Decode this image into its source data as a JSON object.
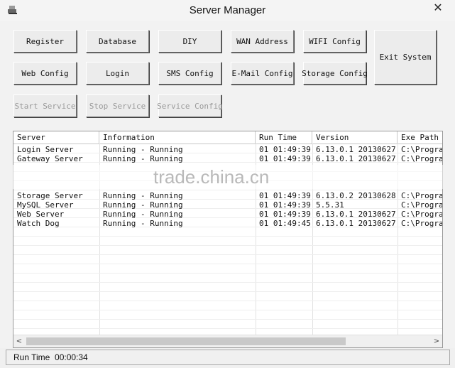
{
  "window": {
    "title": "Server Manager",
    "close_glyph": "✕",
    "icon": "server-app-icon"
  },
  "buttons": {
    "register": "Register",
    "database": "Database",
    "diy": "DIY",
    "wan_address": "WAN Address",
    "wifi_config": "WIFI Config",
    "web_config": "Web Config",
    "login": "Login",
    "sms_config": "SMS Config",
    "email_config": "E-Mail Config",
    "storage_config": "Storage Config",
    "exit_system": "Exit System",
    "start_service": "Start Service",
    "stop_service": "Stop Service",
    "service_config": "Service Config"
  },
  "table": {
    "columns": [
      "Server",
      "Information",
      "Run Time",
      "Version",
      "Exe Path"
    ],
    "rows": [
      [
        "Login Server",
        "Running - Running",
        "01 01:49:39",
        "6.13.0.1 20130627",
        "C:\\Program"
      ],
      [
        "Gateway Server",
        "Running - Running",
        "01 01:49:39",
        "6.13.0.1 20130627",
        "C:\\Program"
      ],
      [
        "Storage Server",
        "Running - Running",
        "01 01:49:39",
        "6.13.0.2 20130628",
        "C:\\Program"
      ],
      [
        "MySQL Server",
        "Running - Running",
        "01 01:49:39",
        "5.5.31",
        "C:\\Program"
      ],
      [
        "Web Server",
        "Running - Running",
        "01 01:49:39",
        "6.13.0.1 20130627",
        "C:\\Program"
      ],
      [
        "Watch Dog",
        "Running - Running",
        "01 01:49:45",
        "6.13.0.1 20130627",
        "C:\\Program"
      ]
    ]
  },
  "scrollbar": {
    "left_glyph": "<",
    "right_glyph": ">"
  },
  "status": {
    "text": "Run Time  00:00:34"
  },
  "watermark": {
    "text": "trade.china.cn"
  },
  "colors": {
    "background": "#f2f2f2",
    "disabled_text": "#9a9a9a"
  }
}
